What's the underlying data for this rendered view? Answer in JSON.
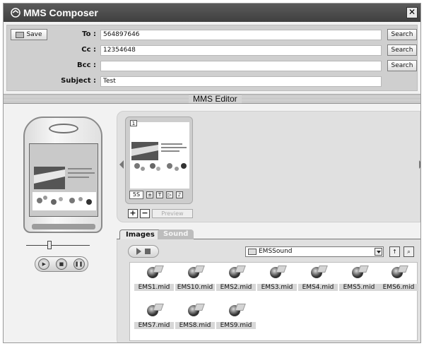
{
  "window": {
    "title": "MMS Composer",
    "close_label": "✕"
  },
  "header": {
    "save_label": "Save",
    "to_label": "To :",
    "to_value": "564897646",
    "cc_label": "Cc :",
    "cc_value": "12354648",
    "bcc_label": "Bcc :",
    "bcc_value": "",
    "subject_label": "Subject :",
    "subject_value": "Test",
    "search_label": "Search"
  },
  "editor": {
    "title": "MMS Editor",
    "slide_number": "1",
    "slide_duration": "5S",
    "add_label": "+",
    "remove_label": "−",
    "preview_label": "Preview"
  },
  "tabs": {
    "images_label": "Images",
    "sound_label": "Sound",
    "active": "Images"
  },
  "sound": {
    "folder": "EMSSound",
    "files": [
      "EMS1.mid",
      "EMS10.mid",
      "EMS2.mid",
      "EMS3.mid",
      "EMS4.mid",
      "EMS5.mid",
      "EMS6.mid",
      "EMS7.mid",
      "EMS8.mid",
      "EMS9.mid"
    ]
  },
  "icons": {
    "app": "app-icon",
    "close": "close-icon",
    "save": "save-icon",
    "folder": "folder-icon",
    "play": "play-icon",
    "stop": "stop-icon",
    "pause": "pause-icon",
    "music_file": "music-file-icon"
  },
  "colors": {
    "titlebar": "#4a4a4a",
    "panel": "#e0e0e0",
    "header": "#cfcfcf"
  }
}
